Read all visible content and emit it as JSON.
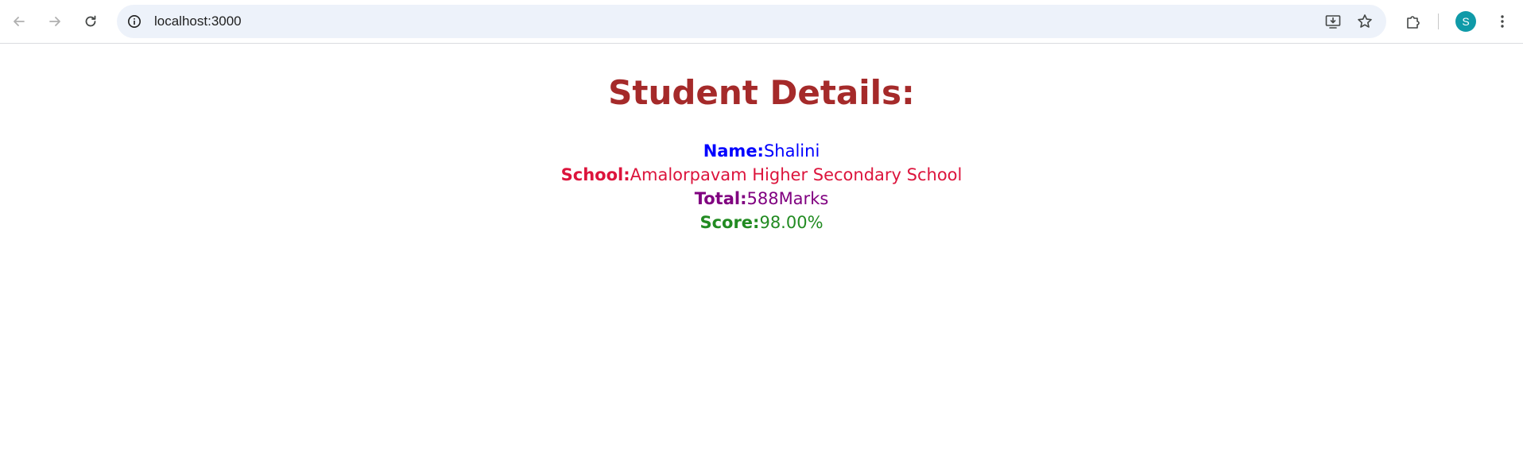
{
  "browser": {
    "url": "localhost:3000",
    "profile_initial": "S",
    "icons": {
      "back": "arrow-left-icon",
      "forward": "arrow-right-icon",
      "reload": "reload-icon",
      "site_info": "info-icon",
      "install": "install-app-icon",
      "bookmark": "star-icon",
      "extensions": "puzzle-icon",
      "menu": "kebab-menu-icon"
    },
    "colors": {
      "omnibox_bg": "#edf2fa",
      "avatar_bg": "#0f9aa8"
    }
  },
  "page": {
    "heading": "Student Details:",
    "heading_color": "#a52a2a",
    "details": [
      {
        "label": "Name:",
        "value": "Shalini",
        "color": "#0000ff"
      },
      {
        "label": "School:",
        "value": "Amalorpavam Higher Secondary School",
        "color": "#dc143c"
      },
      {
        "label": "Total:",
        "value": "588Marks",
        "color": "#800080"
      },
      {
        "label": "Score:",
        "value": "98.00%",
        "color": "#228b22"
      }
    ]
  }
}
